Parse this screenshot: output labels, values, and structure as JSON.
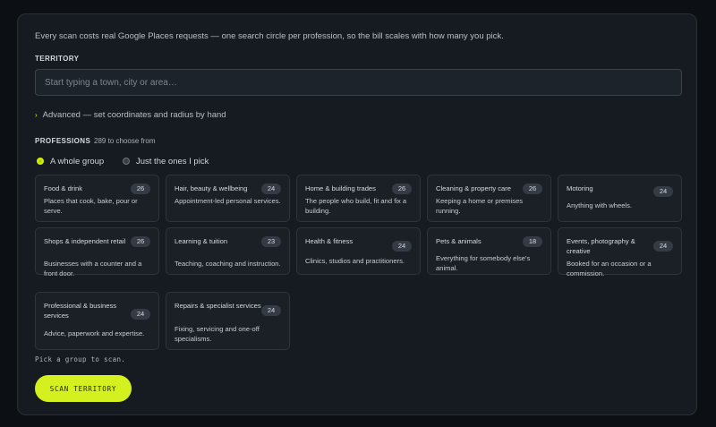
{
  "intro": "Every scan costs real Google Places requests — one search circle per profession, so the bill scales with how many you pick.",
  "territory": {
    "label": "TERRITORY",
    "placeholder": "Start typing a town, city or area…",
    "value": ""
  },
  "advanced": {
    "chevron": "›",
    "label": "Advanced — set coordinates and radius by hand"
  },
  "professions": {
    "label": "PROFESSIONS",
    "count": "289 to choose from",
    "modes": [
      {
        "label": "A whole group",
        "selected": true
      },
      {
        "label": "Just the ones I pick",
        "selected": false
      }
    ],
    "groups": [
      {
        "title": "Food & drink",
        "count": "26",
        "desc": "Places that cook, bake, pour or serve."
      },
      {
        "title": "Hair, beauty & wellbeing",
        "count": "24",
        "desc": "Appointment-led personal services."
      },
      {
        "title": "Home & building trades",
        "count": "26",
        "desc": "The people who build, fit and fix a building."
      },
      {
        "title": "Cleaning & property care",
        "count": "26",
        "desc": "Keeping a home or premises running."
      },
      {
        "title": "Motoring",
        "count": "24",
        "desc": "Anything with wheels."
      },
      {
        "title": "Shops & independent retail",
        "count": "26",
        "desc": "Businesses with a counter and a front door."
      },
      {
        "title": "Learning & tuition",
        "count": "23",
        "desc": "Teaching, coaching and instruction."
      },
      {
        "title": "Health & fitness",
        "count": "24",
        "desc": "Clinics, studios and practitioners."
      },
      {
        "title": "Pets & animals",
        "count": "18",
        "desc": "Everything for somebody else's animal."
      },
      {
        "title": "Events, photography & creative",
        "count": "24",
        "desc": "Booked for an occasion or a commission."
      },
      {
        "title": "Professional & business services",
        "count": "24",
        "desc": "Advice, paperwork and expertise."
      },
      {
        "title": "Repairs & specialist services",
        "count": "24",
        "desc": "Fixing, servicing and one-off specialisms."
      }
    ]
  },
  "hint": "Pick a group to scan.",
  "scan_button": "SCAN TERRITORY",
  "colors": {
    "accent": "#d4f01f",
    "background": "#0c1014",
    "panel": "#161b21",
    "card": "#1b2026"
  }
}
